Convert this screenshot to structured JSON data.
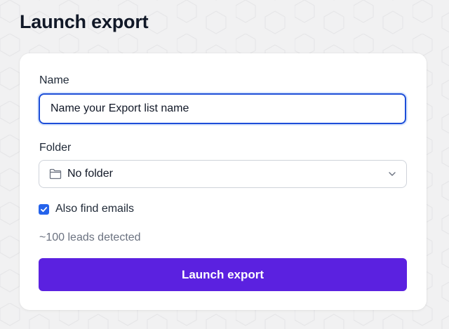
{
  "page": {
    "title": "Launch export"
  },
  "form": {
    "name_label": "Name",
    "name_value": "Name your Export list name",
    "folder_label": "Folder",
    "folder_value": "No folder",
    "also_find_emails_label": "Also find emails",
    "also_find_emails_checked": true,
    "leads_detected": "~100 leads detected",
    "submit_label": "Launch export"
  },
  "icons": {
    "folder": "folder-icon",
    "chevron": "chevron-down-icon",
    "checkmark": "checkmark-icon"
  },
  "colors": {
    "accent_button": "#5b21e0",
    "input_focus_border": "#1d4ed8",
    "checkbox": "#2563eb",
    "background": "#f1f1f2"
  }
}
